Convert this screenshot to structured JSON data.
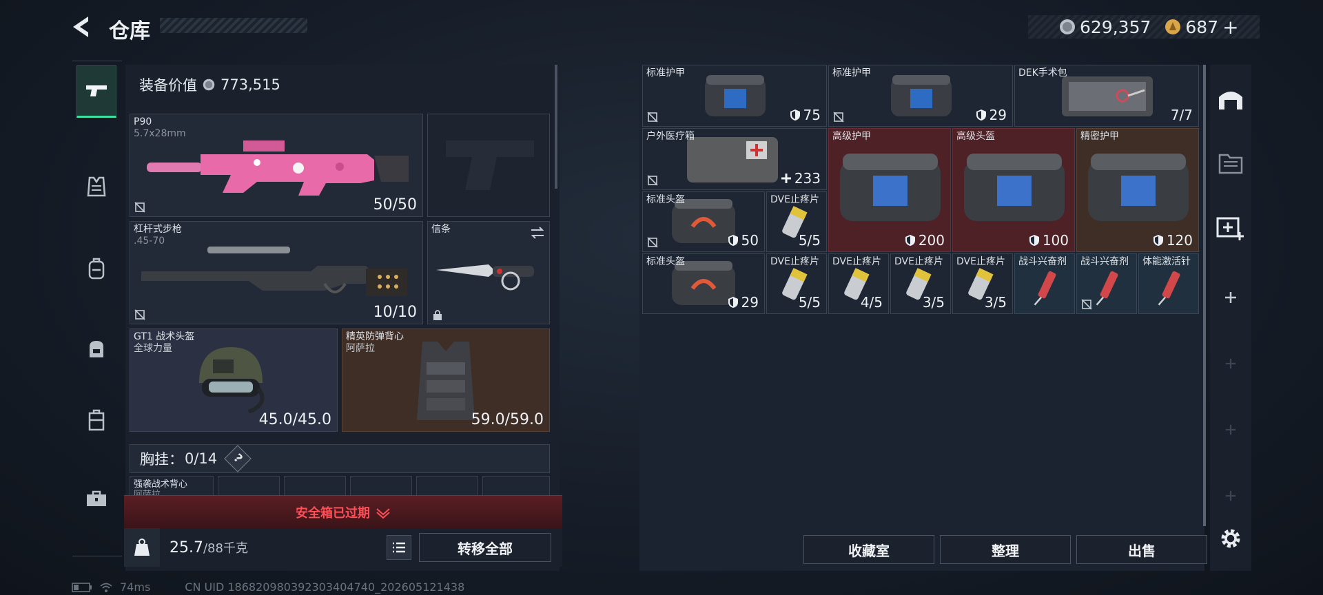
{
  "header": {
    "title": "仓库",
    "currency_silver": "629,357",
    "currency_gold": "687",
    "add_label": "+"
  },
  "left": {
    "equip_value_label": "装备价值",
    "equip_value": "773,515",
    "weapon1": {
      "name": "P90",
      "ammo": "5.7x28mm",
      "count": "50/50"
    },
    "weapon2": {
      "name": "杠杆式步枪",
      "ammo": ".45-70",
      "count": "10/10"
    },
    "melee": {
      "name": "信条"
    },
    "helmet": {
      "name": "GT1 战术头盔",
      "brand": "全球力量",
      "durability": "45.0/45.0"
    },
    "armor": {
      "name": "精英防弹背心",
      "brand": "阿萨拉",
      "durability": "59.0/59.0"
    },
    "chest": {
      "label": "胸挂：",
      "count": "0/14",
      "help": "?"
    },
    "backpack": {
      "name": "强袭战术背心",
      "brand": "阿萨拉"
    },
    "safebox": "安全箱已过期",
    "weight": "25.7",
    "weight_max": "/88千克",
    "transfer_all": "转移全部"
  },
  "stash": {
    "items": [
      {
        "name": "标准护甲",
        "count": "75"
      },
      {
        "name": "标准护甲",
        "count": "29"
      },
      {
        "name": "DEK手术包",
        "count": "7/7"
      },
      {
        "name": "户外医疗箱",
        "count": "233"
      },
      {
        "name": "高级护甲",
        "count": "200"
      },
      {
        "name": "高级头盔",
        "count": "100"
      },
      {
        "name": "精密护甲",
        "count": "120"
      },
      {
        "name": "标准头盔",
        "count": "50"
      },
      {
        "name": "DVE止疼片",
        "count": "5/5"
      },
      {
        "name": "标准头盔",
        "count": "29"
      },
      {
        "name": "DVE止疼片",
        "count": "5/5"
      },
      {
        "name": "DVE止疼片",
        "count": "4/5"
      },
      {
        "name": "DVE止疼片",
        "count": "3/5"
      },
      {
        "name": "DVE止疼片",
        "count": "3/5"
      },
      {
        "name": "战斗兴奋剂",
        "count": ""
      },
      {
        "name": "战斗兴奋剂",
        "count": ""
      },
      {
        "name": "体能激活针",
        "count": ""
      }
    ],
    "buttons": {
      "collection": "收藏室",
      "organize": "整理",
      "sell": "出售"
    }
  },
  "footer": {
    "ping": "74ms",
    "uid": "CN UID 18682098039230340474​0_202605121438"
  },
  "colors": {
    "accent_green": "#3fe0a0",
    "safebox_red": "#e04048",
    "panel_bg": "#1a212c"
  },
  "icons": [
    "back-arrow-icon",
    "silver-coin-icon",
    "gold-coin-icon",
    "pistol-icon",
    "vest-icon",
    "backpack-icon",
    "bag-icon",
    "case-icon",
    "toolbox-icon",
    "helmet-icon",
    "storage-icon",
    "medkit-icon",
    "plus-icon",
    "gear-icon",
    "weight-icon",
    "list-icon",
    "shield-icon",
    "no-bind-icon",
    "lock-icon",
    "swap-icon"
  ]
}
